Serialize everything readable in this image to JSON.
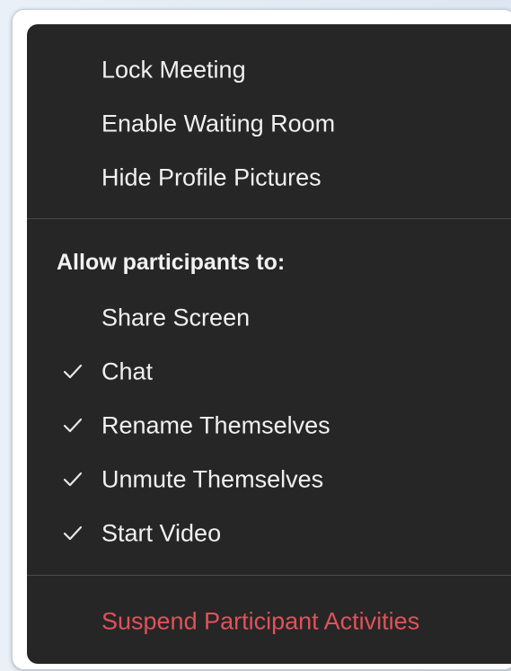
{
  "menu": {
    "top_items": [
      {
        "label": "Lock Meeting",
        "checked": false
      },
      {
        "label": "Enable Waiting Room",
        "checked": false
      },
      {
        "label": "Hide Profile Pictures",
        "checked": false
      }
    ],
    "section_heading": "Allow participants to:",
    "permissions": [
      {
        "label": "Share Screen",
        "checked": false
      },
      {
        "label": "Chat",
        "checked": true
      },
      {
        "label": "Rename Themselves",
        "checked": true
      },
      {
        "label": "Unmute Themselves",
        "checked": true
      },
      {
        "label": "Start Video",
        "checked": true
      }
    ],
    "danger_item": {
      "label": "Suspend Participant Activities"
    },
    "icons": {
      "check": "checkmark-icon"
    },
    "colors": {
      "background": "#262626",
      "text": "#f0f0f0",
      "danger": "#e0525a",
      "divider": "#4a4a4a"
    }
  }
}
